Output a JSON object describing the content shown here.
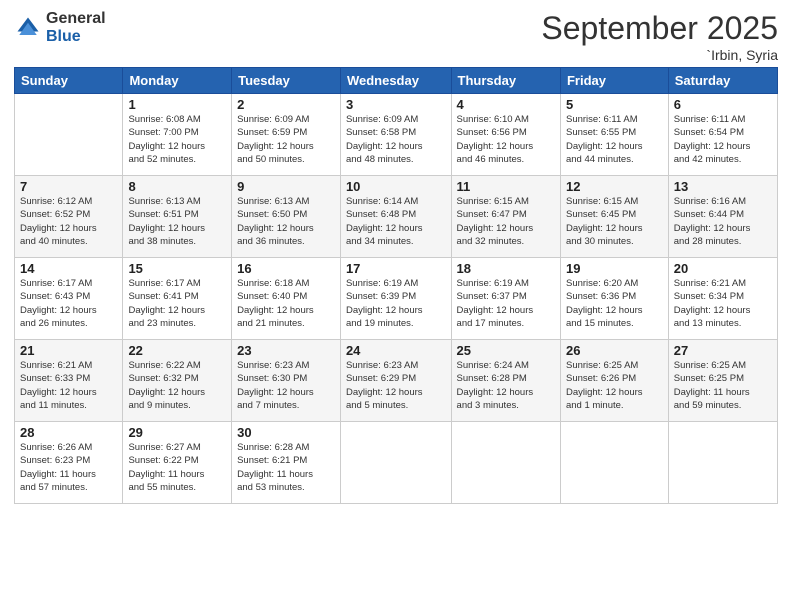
{
  "header": {
    "logo_general": "General",
    "logo_blue": "Blue",
    "month_title": "September 2025",
    "location": "`Irbin, Syria"
  },
  "days_of_week": [
    "Sunday",
    "Monday",
    "Tuesday",
    "Wednesday",
    "Thursday",
    "Friday",
    "Saturday"
  ],
  "weeks": [
    [
      {
        "day": "",
        "info": ""
      },
      {
        "day": "1",
        "info": "Sunrise: 6:08 AM\nSunset: 7:00 PM\nDaylight: 12 hours\nand 52 minutes."
      },
      {
        "day": "2",
        "info": "Sunrise: 6:09 AM\nSunset: 6:59 PM\nDaylight: 12 hours\nand 50 minutes."
      },
      {
        "day": "3",
        "info": "Sunrise: 6:09 AM\nSunset: 6:58 PM\nDaylight: 12 hours\nand 48 minutes."
      },
      {
        "day": "4",
        "info": "Sunrise: 6:10 AM\nSunset: 6:56 PM\nDaylight: 12 hours\nand 46 minutes."
      },
      {
        "day": "5",
        "info": "Sunrise: 6:11 AM\nSunset: 6:55 PM\nDaylight: 12 hours\nand 44 minutes."
      },
      {
        "day": "6",
        "info": "Sunrise: 6:11 AM\nSunset: 6:54 PM\nDaylight: 12 hours\nand 42 minutes."
      }
    ],
    [
      {
        "day": "7",
        "info": "Sunrise: 6:12 AM\nSunset: 6:52 PM\nDaylight: 12 hours\nand 40 minutes."
      },
      {
        "day": "8",
        "info": "Sunrise: 6:13 AM\nSunset: 6:51 PM\nDaylight: 12 hours\nand 38 minutes."
      },
      {
        "day": "9",
        "info": "Sunrise: 6:13 AM\nSunset: 6:50 PM\nDaylight: 12 hours\nand 36 minutes."
      },
      {
        "day": "10",
        "info": "Sunrise: 6:14 AM\nSunset: 6:48 PM\nDaylight: 12 hours\nand 34 minutes."
      },
      {
        "day": "11",
        "info": "Sunrise: 6:15 AM\nSunset: 6:47 PM\nDaylight: 12 hours\nand 32 minutes."
      },
      {
        "day": "12",
        "info": "Sunrise: 6:15 AM\nSunset: 6:45 PM\nDaylight: 12 hours\nand 30 minutes."
      },
      {
        "day": "13",
        "info": "Sunrise: 6:16 AM\nSunset: 6:44 PM\nDaylight: 12 hours\nand 28 minutes."
      }
    ],
    [
      {
        "day": "14",
        "info": "Sunrise: 6:17 AM\nSunset: 6:43 PM\nDaylight: 12 hours\nand 26 minutes."
      },
      {
        "day": "15",
        "info": "Sunrise: 6:17 AM\nSunset: 6:41 PM\nDaylight: 12 hours\nand 23 minutes."
      },
      {
        "day": "16",
        "info": "Sunrise: 6:18 AM\nSunset: 6:40 PM\nDaylight: 12 hours\nand 21 minutes."
      },
      {
        "day": "17",
        "info": "Sunrise: 6:19 AM\nSunset: 6:39 PM\nDaylight: 12 hours\nand 19 minutes."
      },
      {
        "day": "18",
        "info": "Sunrise: 6:19 AM\nSunset: 6:37 PM\nDaylight: 12 hours\nand 17 minutes."
      },
      {
        "day": "19",
        "info": "Sunrise: 6:20 AM\nSunset: 6:36 PM\nDaylight: 12 hours\nand 15 minutes."
      },
      {
        "day": "20",
        "info": "Sunrise: 6:21 AM\nSunset: 6:34 PM\nDaylight: 12 hours\nand 13 minutes."
      }
    ],
    [
      {
        "day": "21",
        "info": "Sunrise: 6:21 AM\nSunset: 6:33 PM\nDaylight: 12 hours\nand 11 minutes."
      },
      {
        "day": "22",
        "info": "Sunrise: 6:22 AM\nSunset: 6:32 PM\nDaylight: 12 hours\nand 9 minutes."
      },
      {
        "day": "23",
        "info": "Sunrise: 6:23 AM\nSunset: 6:30 PM\nDaylight: 12 hours\nand 7 minutes."
      },
      {
        "day": "24",
        "info": "Sunrise: 6:23 AM\nSunset: 6:29 PM\nDaylight: 12 hours\nand 5 minutes."
      },
      {
        "day": "25",
        "info": "Sunrise: 6:24 AM\nSunset: 6:28 PM\nDaylight: 12 hours\nand 3 minutes."
      },
      {
        "day": "26",
        "info": "Sunrise: 6:25 AM\nSunset: 6:26 PM\nDaylight: 12 hours\nand 1 minute."
      },
      {
        "day": "27",
        "info": "Sunrise: 6:25 AM\nSunset: 6:25 PM\nDaylight: 11 hours\nand 59 minutes."
      }
    ],
    [
      {
        "day": "28",
        "info": "Sunrise: 6:26 AM\nSunset: 6:23 PM\nDaylight: 11 hours\nand 57 minutes."
      },
      {
        "day": "29",
        "info": "Sunrise: 6:27 AM\nSunset: 6:22 PM\nDaylight: 11 hours\nand 55 minutes."
      },
      {
        "day": "30",
        "info": "Sunrise: 6:28 AM\nSunset: 6:21 PM\nDaylight: 11 hours\nand 53 minutes."
      },
      {
        "day": "",
        "info": ""
      },
      {
        "day": "",
        "info": ""
      },
      {
        "day": "",
        "info": ""
      },
      {
        "day": "",
        "info": ""
      }
    ]
  ]
}
